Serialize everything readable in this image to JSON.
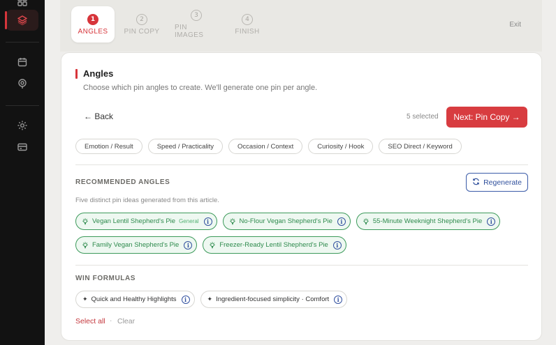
{
  "stepper": {
    "steps": [
      {
        "num": "1",
        "label": "ANGLES"
      },
      {
        "num": "2",
        "label": "PIN COPY"
      },
      {
        "num": "3",
        "label": "PIN IMAGES"
      },
      {
        "num": "4",
        "label": "FINISH"
      }
    ],
    "exit_label": "Exit"
  },
  "sidebar": {
    "icons": [
      "grid-icon",
      "layers-icon",
      "calendar-icon",
      "pin-icon",
      "gear-icon",
      "card-icon"
    ],
    "accent": "#d7353b"
  },
  "main": {
    "title": "Angles",
    "subtitle": "Choose which pin angles to create. We'll generate one pin per angle.",
    "back_label": "← Back",
    "selected_count": "5 selected",
    "next_label": "Next: Pin Copy →",
    "filters": [
      "Emotion / Result",
      "Speed / Practicality",
      "Occasion / Context",
      "Curiosity / Hook",
      "SEO Direct / Keyword"
    ],
    "recommended": {
      "heading": "RECOMMENDED ANGLES",
      "subheading": "Five distinct pin ideas generated from this article.",
      "regenerate_label": "Regenerate",
      "angles": [
        {
          "label": "Vegan Lentil Shepherd's Pie",
          "tag": "General"
        },
        {
          "label": "No-Flour Vegan Shepherd's Pie",
          "tag": ""
        },
        {
          "label": "55-Minute Weeknight Shepherd's Pie",
          "tag": ""
        },
        {
          "label": "Family Vegan Shepherd's Pie",
          "tag": ""
        },
        {
          "label": "Freezer-Ready Lentil Shepherd's Pie",
          "tag": ""
        }
      ]
    },
    "win_formulas": {
      "heading": "WIN FORMULAS",
      "items": [
        "Quick and Healthy Highlights",
        "Ingredient-focused simplicity · Comfort"
      ]
    },
    "select_all_label": "Select all",
    "separator": "·",
    "clear_label": "Clear"
  },
  "colors": {
    "accent_red": "#d83c40",
    "selected_green": "#3c9a5a",
    "info_blue": "#3352a0"
  }
}
